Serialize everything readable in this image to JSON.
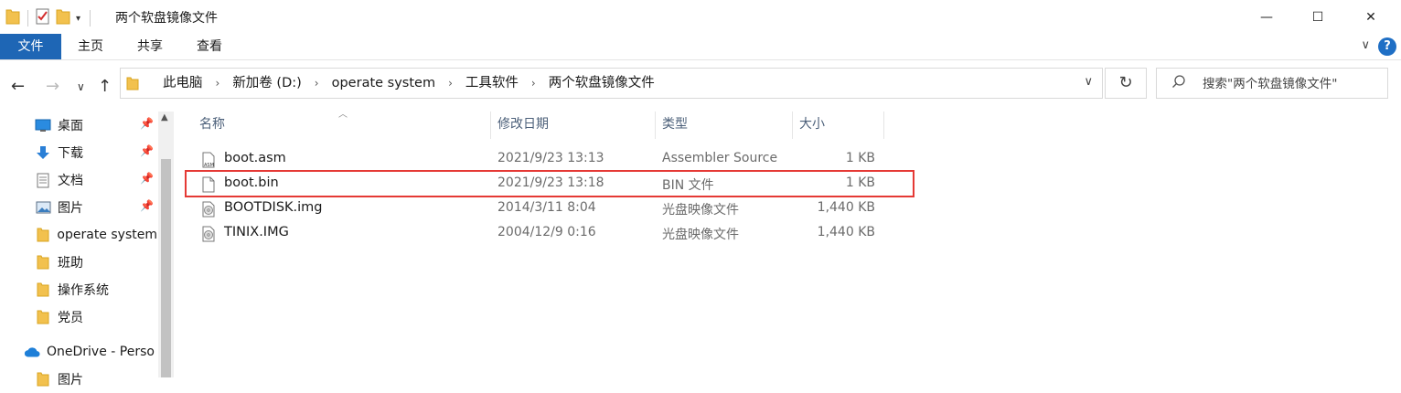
{
  "window": {
    "title": "两个软盘镜像文件",
    "minimize": "—",
    "maximize": "☐",
    "close": "✕"
  },
  "ribbon": {
    "tabs": [
      "文件",
      "主页",
      "共享",
      "查看"
    ],
    "expand": "∨",
    "help": "?"
  },
  "nav": {
    "back": "←",
    "forward": "→",
    "recent": "∨",
    "up": "↑",
    "breadcrumb": [
      "此电脑",
      "新加卷 (D:)",
      "operate system",
      "工具软件",
      "两个软盘镜像文件"
    ],
    "breadcrumb_sep": "›",
    "dropdown": "∨",
    "refresh": "↻",
    "search_placeholder": "搜索\"两个软盘镜像文件\""
  },
  "sidebar": {
    "items": [
      {
        "label": "桌面",
        "icon": "desktop-icon",
        "pinned": true
      },
      {
        "label": "下载",
        "icon": "download-icon",
        "pinned": true
      },
      {
        "label": "文档",
        "icon": "document-icon",
        "pinned": true
      },
      {
        "label": "图片",
        "icon": "pictures-icon",
        "pinned": true
      },
      {
        "label": "operate system",
        "icon": "folder-icon",
        "pinned": false
      },
      {
        "label": "班助",
        "icon": "folder-icon",
        "pinned": false
      },
      {
        "label": "操作系统",
        "icon": "folder-icon",
        "pinned": false
      },
      {
        "label": "党员",
        "icon": "folder-icon",
        "pinned": false
      },
      {
        "label": "OneDrive - Perso",
        "icon": "onedrive-icon",
        "pinned": false
      },
      {
        "label": "图片",
        "icon": "folder-icon",
        "pinned": false
      }
    ]
  },
  "files": {
    "columns": {
      "name": "名称",
      "date": "修改日期",
      "type": "类型",
      "size": "大小"
    },
    "rows": [
      {
        "name": "boot.asm",
        "date": "2021/9/23 13:13",
        "type": "Assembler Source",
        "size": "1 KB",
        "icon": "asm-file-icon"
      },
      {
        "name": "boot.bin",
        "date": "2021/9/23 13:18",
        "type": "BIN 文件",
        "size": "1 KB",
        "icon": "blank-file-icon"
      },
      {
        "name": "BOOTDISK.img",
        "date": "2014/3/11 8:04",
        "type": "光盘映像文件",
        "size": "1,440 KB",
        "icon": "disc-image-icon"
      },
      {
        "name": "TINIX.IMG",
        "date": "2004/12/9 0:16",
        "type": "光盘映像文件",
        "size": "1,440 KB",
        "icon": "disc-image-icon"
      }
    ]
  },
  "colors": {
    "accent": "#1e66b5",
    "folder": "#f2c14e",
    "highlight": "#e53935"
  }
}
